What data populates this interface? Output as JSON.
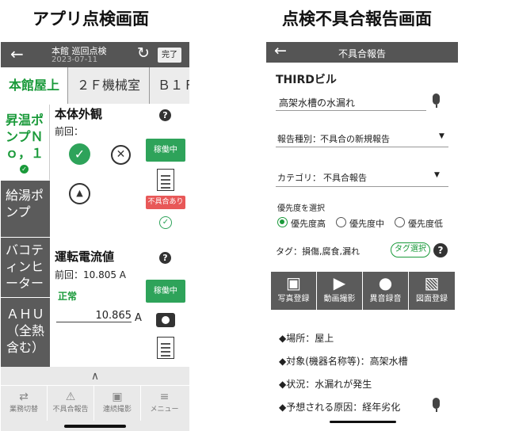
{
  "captions": {
    "left": "アプリ点検画面",
    "right": "点検不具合報告画面"
  },
  "left": {
    "header": {
      "title": "本館 巡回点検",
      "date": "2023-07-11",
      "done": "完了"
    },
    "tabs": [
      "本館屋上",
      "２Ｆ機械室",
      "Ｂ１Ｆ"
    ],
    "sidebar": [
      {
        "label": "昇温ポンプＮｏ，１"
      },
      {
        "label": "給湯ポンプ"
      },
      {
        "label": "バコティンヒーター"
      },
      {
        "label": "ＡＨＵ（全熱含む）"
      }
    ],
    "card1": {
      "title": "本体外観",
      "prev": "前回：",
      "running": "稼働中",
      "defect": "不具合あり"
    },
    "card2": {
      "title": "運転電流値",
      "prev": "前回：10.805 A",
      "status": "正常",
      "running": "稼働中",
      "value": "10.865",
      "unit": "A"
    },
    "footer": [
      "業務切替",
      "不具合報告",
      "連続撮影",
      "メニュー"
    ]
  },
  "right": {
    "header": {
      "title": "不具合報告"
    },
    "building": "THIRDビル",
    "subject": "高架水槽の水漏れ",
    "report_type_label": "報告種別：",
    "report_type_value": "不具合の新規報告",
    "category_label": "カテゴリ：",
    "category_value": "不具合報告",
    "priority_label": "優先度を選択",
    "priorities": [
      "優先度高",
      "優先度中",
      "優先度低"
    ],
    "tag": "タグ：損傷,腐食,漏れ",
    "tag_button": "タグ選択",
    "actions": [
      "写真登録",
      "動画撮影",
      "異音録音",
      "図面登録"
    ],
    "info": [
      "◆場所：屋上",
      "◆対象(機器名称等)：高架水槽",
      "◆状況：水漏れが発生",
      "◆予想される原因：経年劣化"
    ]
  }
}
